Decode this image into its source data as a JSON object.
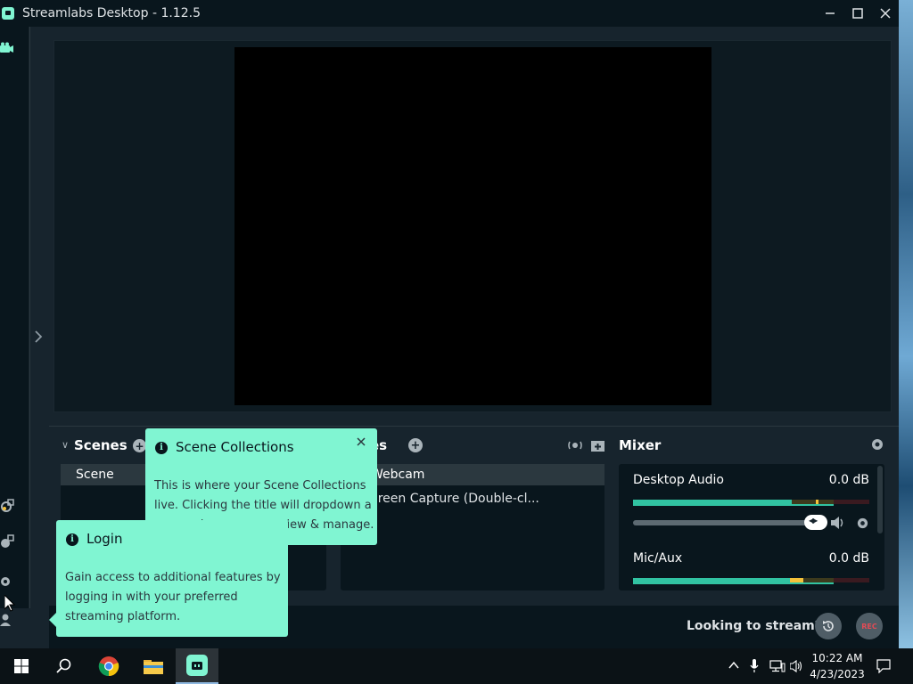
{
  "window": {
    "title": "Streamlabs Desktop - 1.12.5",
    "controls": {
      "minimize": "—",
      "maximize": "☐",
      "close": "✕"
    }
  },
  "sidebar": {
    "icons": [
      "studio-icon",
      "overlay-icon",
      "widget-icon",
      "settings-icon",
      "account-icon"
    ]
  },
  "scenes": {
    "title": "Scenes",
    "items": [
      {
        "label": "Scene",
        "selected": true
      }
    ]
  },
  "sources": {
    "title_partial": "es",
    "items": [
      {
        "label": "Webcam",
        "selected": true
      },
      {
        "label": "creen Capture (Double-cl...",
        "selected": false
      }
    ]
  },
  "mixer": {
    "title": "Mixer",
    "channels": [
      {
        "name": "Desktop Audio",
        "level": "0.0 dB"
      },
      {
        "name": "Mic/Aux",
        "level": "0.0 dB"
      }
    ]
  },
  "footer": {
    "prompt": "Looking to stream?",
    "rec_label": "REC"
  },
  "tooltips": {
    "scene_collections": {
      "title": "Scene Collections",
      "body": "This is where your Scene Collections live. Clicking the title will dropdown a menu where you can view & manage.",
      "lines": [
        "This is where your Scene Collections",
        "live. Clicking the title will dropdown a",
        "menu where you can view & manage."
      ]
    },
    "login": {
      "title": "Login",
      "body": "Gain access to additional features by logging in with your preferred streaming platform.",
      "lines": [
        "Gain access to additional features by",
        "logging in with your preferred",
        "streaming platform."
      ]
    }
  },
  "taskbar": {
    "time": "10:22 AM",
    "date": "4/23/2023",
    "apps": [
      "start-icon",
      "search-icon",
      "chrome-icon",
      "file-explorer-icon",
      "streamlabs-icon"
    ]
  },
  "colors": {
    "accent": "#80f5d2",
    "panel_bg": "#09161d",
    "window_bg": "#17242d",
    "meter_green": "#31c3a2",
    "meter_yellow": "#f5c23a",
    "meter_red": "#e34b55"
  }
}
